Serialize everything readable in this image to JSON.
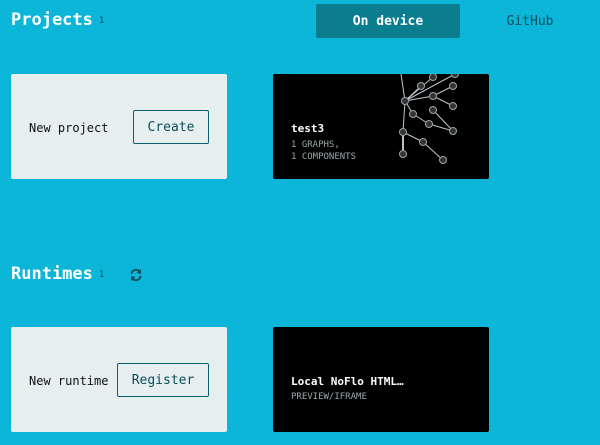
{
  "projects": {
    "title": "Projects",
    "count": "1",
    "tabs": [
      {
        "label": "On device",
        "active": true
      },
      {
        "label": "GitHub",
        "active": false
      }
    ],
    "new_card": {
      "label": "New project",
      "button": "Create"
    },
    "items": [
      {
        "name": "test3",
        "graphs": "1 GRAPHS,",
        "components": "1 COMPONENTS"
      }
    ]
  },
  "runtimes": {
    "title": "Runtimes",
    "count": "1",
    "refresh_icon": "refresh-icon",
    "new_card": {
      "label": "New runtime",
      "button": "Register"
    },
    "items": [
      {
        "name": "Local NoFlo HTML…",
        "detail": "PREVIEW/IFRAME"
      }
    ]
  },
  "colors": {
    "background": "#0bb6d9",
    "active_tab": "#0a7e8f",
    "card_light": "#e6eef0",
    "card_dark": "#000000"
  }
}
